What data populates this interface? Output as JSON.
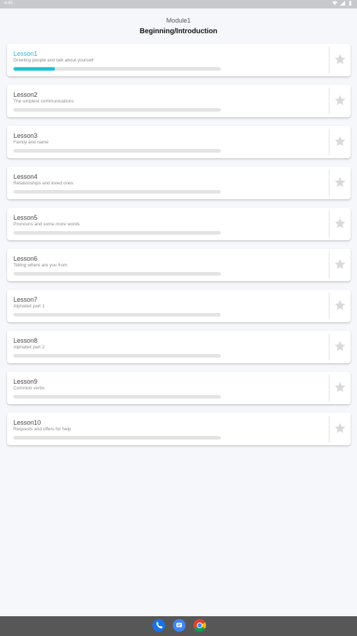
{
  "statusbar": {
    "time": "4:45"
  },
  "header": {
    "module": "Module1",
    "title": "Beginning/Introduction"
  },
  "lessons": [
    {
      "name": "Lesson1",
      "subtitle": "Greeting people and talk about yourself",
      "progress": 0.2,
      "active": true
    },
    {
      "name": "Lesson2",
      "subtitle": "The simplest communications",
      "progress": 0
    },
    {
      "name": "Lesson3",
      "subtitle": "Family and name",
      "progress": 0
    },
    {
      "name": "Lesson4",
      "subtitle": "Relationships and loved ones",
      "progress": 0
    },
    {
      "name": "Lesson5",
      "subtitle": "Pronouns and some more words",
      "progress": 0
    },
    {
      "name": "Lesson6",
      "subtitle": "Telling where are you from",
      "progress": 0
    },
    {
      "name": "Lesson7",
      "subtitle": "Alphabet part 1",
      "progress": 0
    },
    {
      "name": "Lesson8",
      "subtitle": "Alphabet part 2",
      "progress": 0
    },
    {
      "name": "Lesson9",
      "subtitle": "Common verbs",
      "progress": 0
    },
    {
      "name": "Lesson10",
      "subtitle": "Requests and offers for help",
      "progress": 0
    }
  ],
  "colors": {
    "accent": "#1ec3d7",
    "active_title": "#29b6d3",
    "star": "#d9d9d9",
    "nav_bar": "#575757"
  },
  "icons": {
    "favorite": "star-icon",
    "nav": [
      "phone-icon",
      "messages-icon",
      "chrome-icon"
    ]
  }
}
